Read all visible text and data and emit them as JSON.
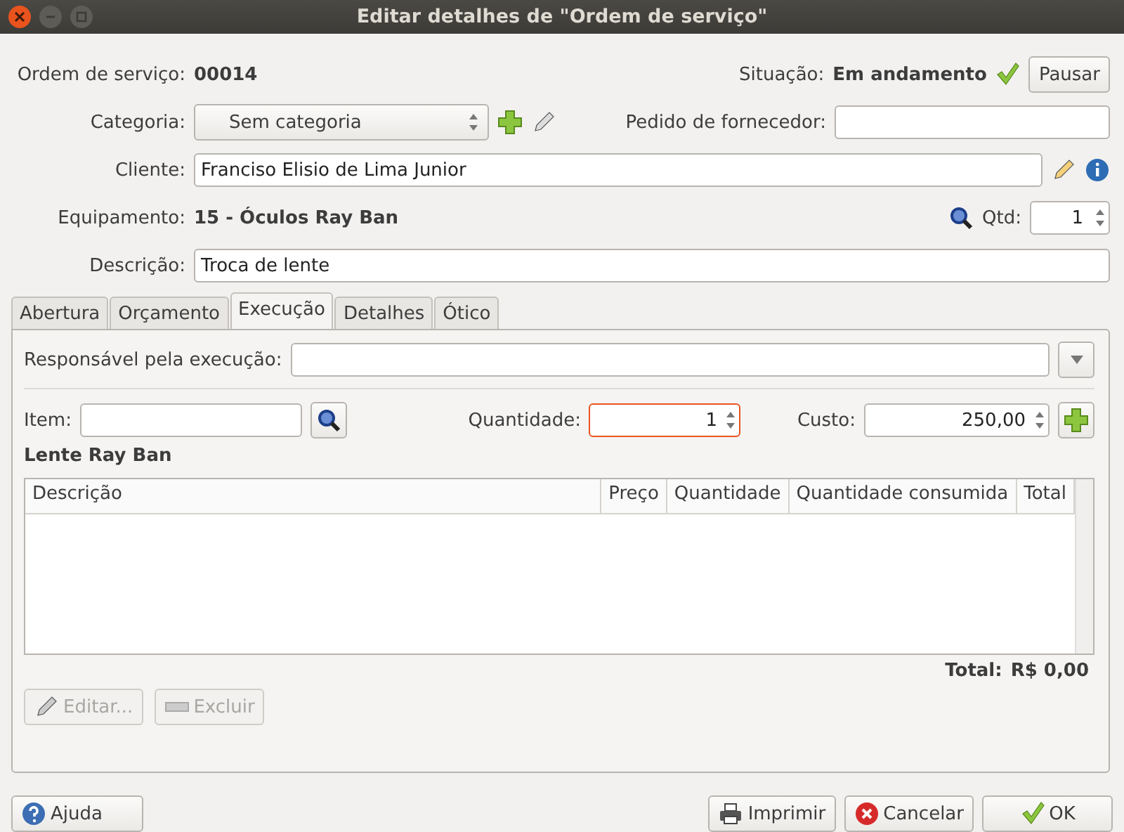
{
  "window": {
    "title": "Editar detalhes de \"Ordem de serviço\""
  },
  "header": {
    "order_label": "Ordem de serviço:",
    "order_number": "00014",
    "status_label": "Situação:",
    "status_value": "Em andamento",
    "pause_button": "Pausar"
  },
  "category": {
    "label": "Categoria:",
    "value": "Sem categoria"
  },
  "supplier_order": {
    "label": "Pedido de fornecedor:"
  },
  "client": {
    "label": "Cliente:",
    "value": "Franciso Elisio de Lima Junior"
  },
  "equipment": {
    "label": "Equipamento:",
    "value": "15 - Óculos Ray Ban"
  },
  "quantity_top": {
    "label": "Qtd:",
    "value": "1"
  },
  "description": {
    "label": "Descrição:",
    "value": "Troca de lente"
  },
  "tabs": [
    {
      "label": "Abertura",
      "selected": false
    },
    {
      "label": "Orçamento",
      "selected": false
    },
    {
      "label": "Execução",
      "selected": true
    },
    {
      "label": "Detalhes",
      "selected": false
    },
    {
      "label": "Ótico",
      "selected": false
    }
  ],
  "execution": {
    "responsible_label": "Responsável pela execução:",
    "item_label": "Item:",
    "quantity": {
      "label": "Quantidade:",
      "value": "1",
      "focused": true
    },
    "cost": {
      "label": "Custo:",
      "value": "250,00"
    },
    "product_name": "Lente Ray Ban",
    "table": {
      "columns": [
        "Descrição",
        "Preço",
        "Quantidade",
        "Quantidade consumida",
        "Total"
      ]
    },
    "total_label": "Total:",
    "total_value": "R$ 0,00",
    "actions": [
      {
        "label": "Editar...",
        "kind": "edit",
        "disabled": true
      },
      {
        "label": "Excluir",
        "kind": "delete",
        "disabled": true
      }
    ]
  },
  "footer": [
    {
      "label": "Ajuda",
      "kind": "help"
    },
    {
      "label": "Imprimir",
      "kind": "print"
    },
    {
      "label": "Cancelar",
      "kind": "cancel"
    },
    {
      "label": "OK",
      "kind": "ok"
    }
  ]
}
